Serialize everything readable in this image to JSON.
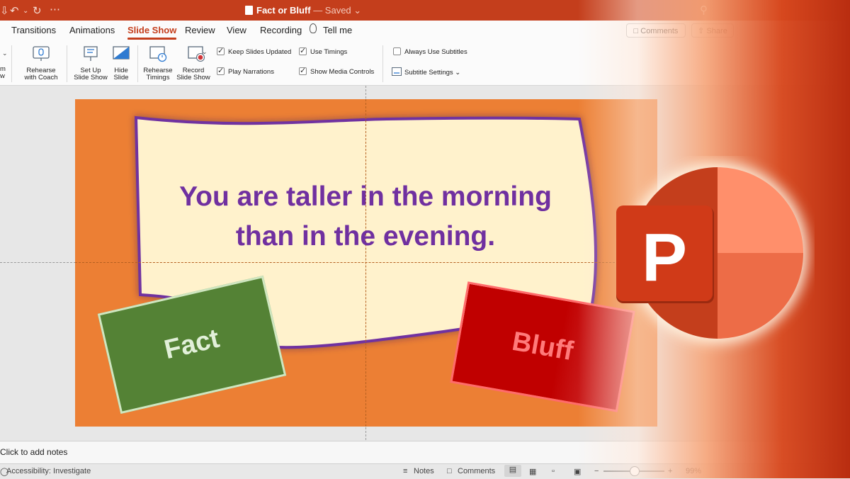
{
  "window": {
    "title": "Fact or Bluff",
    "saved_status": "— Saved"
  },
  "tabs": [
    {
      "label": "Transitions"
    },
    {
      "label": "Animations"
    },
    {
      "label": "Slide Show",
      "active": true
    },
    {
      "label": "Review"
    },
    {
      "label": "View"
    },
    {
      "label": "Recording"
    },
    {
      "label": "Tell me"
    }
  ],
  "header_buttons": {
    "comments": "Comments",
    "share": "Share"
  },
  "ribbon": {
    "partial_left": [
      "m",
      "w"
    ],
    "rehearse_with_coach": [
      "Rehearse",
      "with Coach"
    ],
    "set_up_slide_show": [
      "Set Up",
      "Slide Show"
    ],
    "hide_slide": [
      "Hide",
      "Slide"
    ],
    "rehearse_timings": [
      "Rehearse",
      "Timings"
    ],
    "record_slide_show": [
      "Record",
      "Slide Show"
    ],
    "checkboxes": [
      {
        "label": "Keep Slides Updated",
        "checked": true
      },
      {
        "label": "Use Timings",
        "checked": true
      },
      {
        "label": "Play Narrations",
        "checked": true
      },
      {
        "label": "Show Media Controls",
        "checked": true
      },
      {
        "label": "Always Use Subtitles",
        "checked": false
      }
    ],
    "subtitle_settings": "Subtitle Settings"
  },
  "slide": {
    "question_line1": "You are taller in the morning",
    "question_line2": "than in the evening.",
    "fact_label": "Fact",
    "bluff_label": "Bluff"
  },
  "notes": {
    "placeholder": "Click to add notes"
  },
  "status_bar": {
    "accessibility": "Accessibility: Investigate",
    "notes": "Notes",
    "comments": "Comments",
    "zoom": "99%"
  },
  "logo": {
    "letter": "P",
    "name": "PowerPoint"
  },
  "colors": {
    "accent": "#c43e1c",
    "slide_background": "#ec7f34",
    "question_text": "#7030a0",
    "fact_card": "#548235",
    "bluff_card": "#c00000"
  }
}
